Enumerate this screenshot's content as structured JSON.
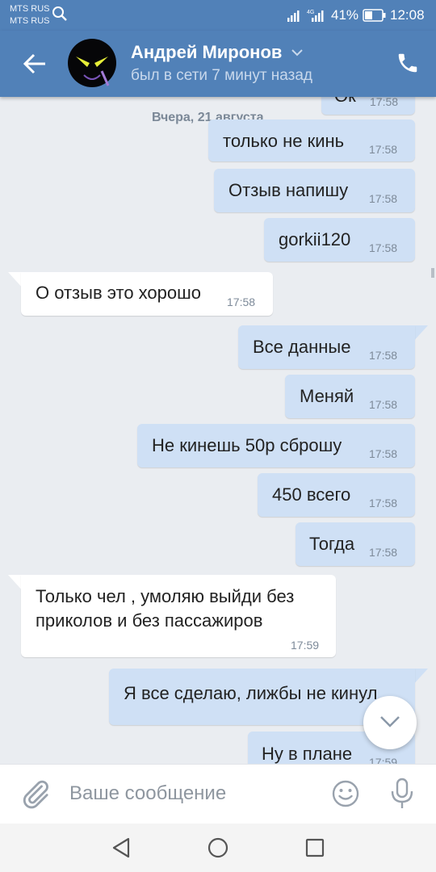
{
  "status": {
    "carrier1": "MTS RUS",
    "carrier2": "MTS RUS",
    "network": "4G",
    "battery": "41%",
    "time": "12:08"
  },
  "header": {
    "name": "Андрей Миронов",
    "status": "был в сети 7 минут назад"
  },
  "chat": {
    "top_partial": {
      "text": "Ок",
      "time": "17:58"
    },
    "date_separator": "Вчера, 21 августа",
    "messages": [
      {
        "dir": "out",
        "text": "только не кинь",
        "time": "17:58"
      },
      {
        "dir": "out",
        "text": "Отзыв напишу",
        "time": "17:58"
      },
      {
        "dir": "out",
        "text": "gorkii120",
        "time": "17:58"
      },
      {
        "dir": "in",
        "text": "О отзыв это хорошо",
        "time": "17:58"
      },
      {
        "dir": "out",
        "text": "Все данные",
        "time": "17:58"
      },
      {
        "dir": "out",
        "text": "Меняй",
        "time": "17:58"
      },
      {
        "dir": "out",
        "text": "Не кинешь 50р сброшу",
        "time": "17:58"
      },
      {
        "dir": "out",
        "text": "450 всего",
        "time": "17:58"
      },
      {
        "dir": "out",
        "text": "Тогда",
        "time": "17:58"
      },
      {
        "dir": "in",
        "line1": "Только чел , умоляю выйди без",
        "line2": "приколов и без пассажиров",
        "time": "17:59"
      },
      {
        "dir": "out",
        "text": "Я все сделаю, лижбы не кинул",
        "time": ""
      },
      {
        "dir": "out",
        "text": "Ну в плане",
        "time": "17:59"
      }
    ]
  },
  "composer": {
    "placeholder": "Ваше сообщение"
  },
  "colors": {
    "header": "#5181b8",
    "outgoing": "#cfe0f5",
    "incoming": "#ffffff",
    "background": "#eaedf1"
  },
  "icons": [
    "search-icon",
    "signal-icon",
    "battery-icon",
    "back-arrow-icon",
    "avatar",
    "chevron-down-icon",
    "phone-icon",
    "paperclip-icon",
    "emoji-icon",
    "microphone-icon",
    "nav-back-icon",
    "nav-home-icon",
    "nav-recents-icon",
    "scroll-down-icon"
  ]
}
